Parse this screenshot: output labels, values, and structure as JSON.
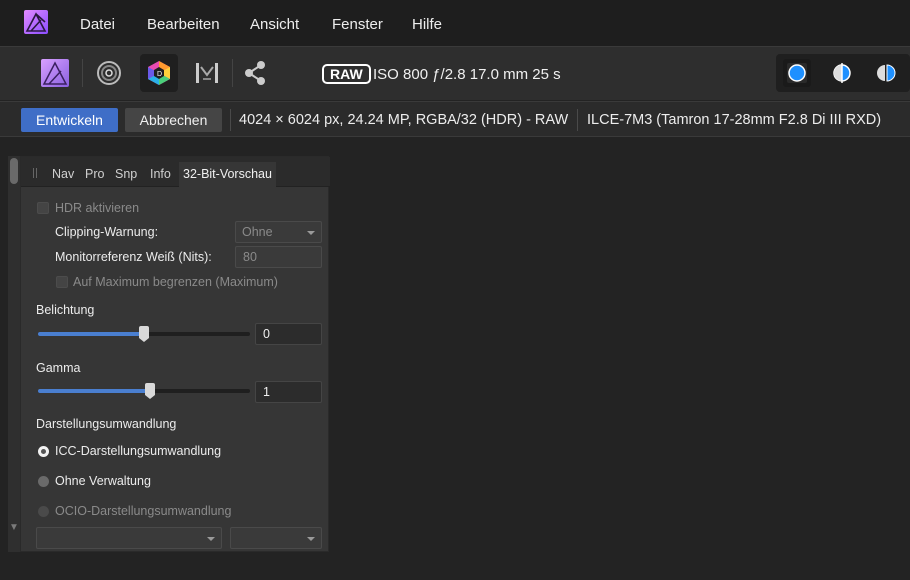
{
  "menu": {
    "items": [
      "Datei",
      "Bearbeiten",
      "Ansicht",
      "Fenster",
      "Hilfe"
    ]
  },
  "toolbar": {
    "raw_badge": "RAW",
    "exif": "ISO 800 ƒ/2.8 17.0 mm 25 s"
  },
  "context": {
    "develop_label": "Entwickeln",
    "cancel_label": "Abbrechen",
    "image_info": "4024 × 6024 px, 24.24 MP, RGBA/32 (HDR) - RAW",
    "camera_info": "ILCE-7M3 (Tamron 17-28mm F2.8 Di III RXD)"
  },
  "panel": {
    "tabs": [
      "Nav",
      "Pro",
      "Snp",
      "Info",
      "32-Bit-Vorschau"
    ],
    "hdr_enable": "HDR aktivieren",
    "clipping_label": "Clipping-Warnung:",
    "clipping_value": "Ohne",
    "monitor_ref_label": "Monitorreferenz Weiß (Nits):",
    "monitor_ref_value": "80",
    "limit_max": "Auf Maximum begrenzen (Maximum)",
    "exposure_label": "Belichtung",
    "exposure_value": "0",
    "exposure_slider": 0.5,
    "gamma_label": "Gamma",
    "gamma_value": "1",
    "gamma_slider": 0.53,
    "display_transform_label": "Darstellungsumwandlung",
    "radio_icc": "ICC-Darstellungsumwandlung",
    "radio_unmanaged": "Ohne Verwaltung",
    "radio_ocio": "OCIO-Darstellungsumwandlung",
    "ocio_dropdown_1": "",
    "ocio_dropdown_2": ""
  },
  "colors": {
    "accent": "#3f6ec7",
    "slider_fill": "#4a7fd0",
    "logo": "#c86bff"
  }
}
